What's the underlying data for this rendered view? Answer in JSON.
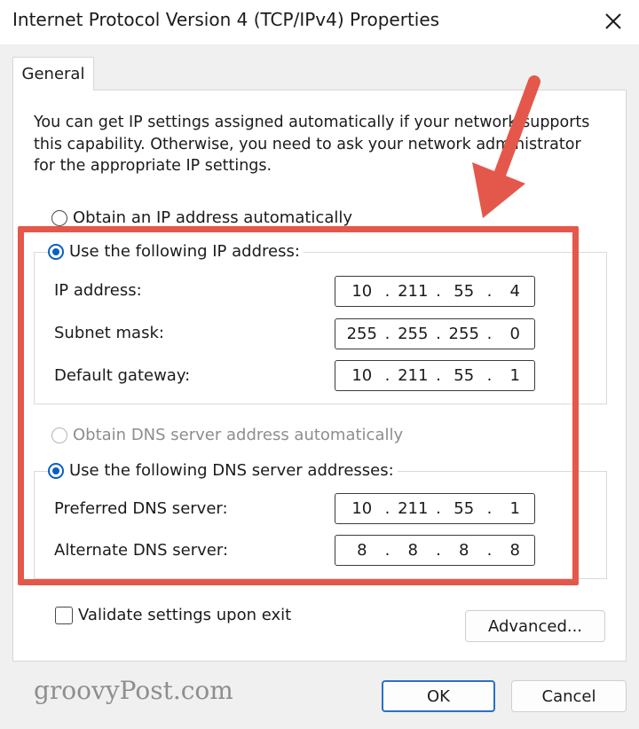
{
  "window": {
    "title": "Internet Protocol Version 4 (TCP/IPv4) Properties",
    "close_icon": "close-icon"
  },
  "tabs": [
    {
      "label": "General",
      "selected": true
    }
  ],
  "description": "You can get IP settings assigned automatically if your network supports this capability. Otherwise, you need to ask your network administrator for the appropriate IP settings.",
  "ip": {
    "auto_option": "Obtain an IP address automatically",
    "manual_option": "Use the following IP address:",
    "selected": "manual",
    "fields": [
      {
        "label": "IP address:",
        "octets": [
          "10",
          "211",
          "55",
          "4"
        ]
      },
      {
        "label": "Subnet mask:",
        "octets": [
          "255",
          "255",
          "255",
          "0"
        ]
      },
      {
        "label": "Default gateway:",
        "octets": [
          "10",
          "211",
          "55",
          "1"
        ]
      }
    ]
  },
  "dns": {
    "auto_option": "Obtain DNS server address automatically",
    "manual_option": "Use the following DNS server addresses:",
    "selected": "manual",
    "fields": [
      {
        "label": "Preferred DNS server:",
        "octets": [
          "10",
          "211",
          "55",
          "1"
        ]
      },
      {
        "label": "Alternate DNS server:",
        "octets": [
          "8",
          "8",
          "8",
          "8"
        ]
      }
    ]
  },
  "validate_checkbox": {
    "label": "Validate settings upon exit",
    "checked": false
  },
  "buttons": {
    "advanced": "Advanced...",
    "ok": "OK",
    "cancel": "Cancel"
  },
  "watermark": "groovyPost.com",
  "colors": {
    "highlight": "#e4584b",
    "accent": "#0a5fc0"
  }
}
